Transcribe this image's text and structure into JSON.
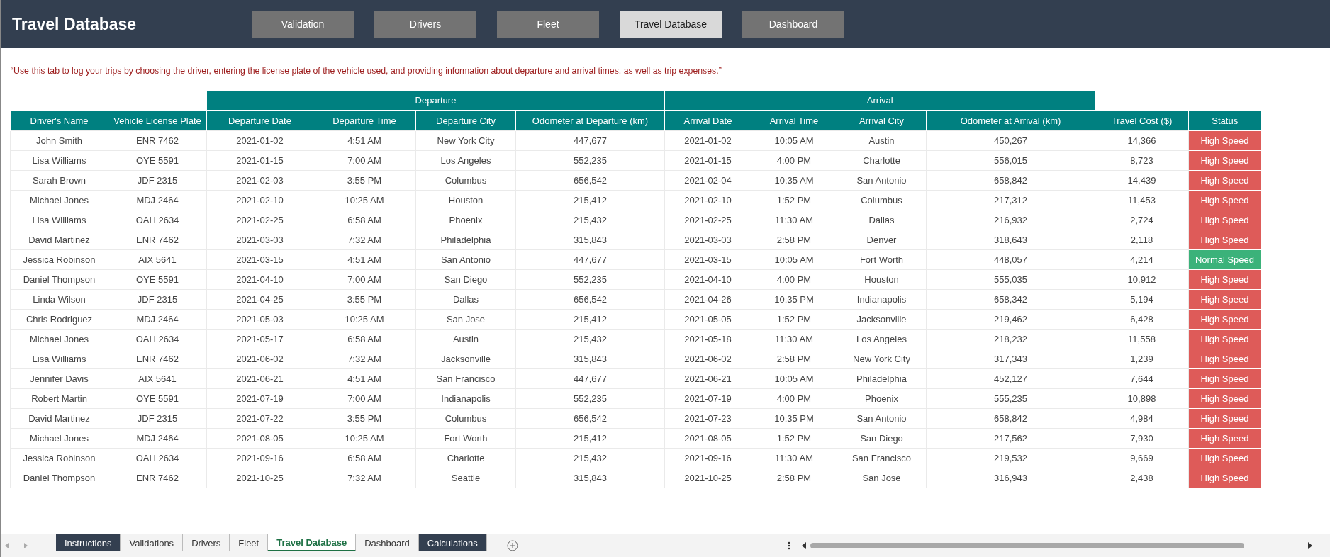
{
  "header": {
    "title": "Travel Database",
    "nav": [
      {
        "label": "Validation",
        "selected": false
      },
      {
        "label": "Drivers",
        "selected": false
      },
      {
        "label": "Fleet",
        "selected": false
      },
      {
        "label": "Travel Database",
        "selected": true
      },
      {
        "label": "Dashboard",
        "selected": false
      }
    ]
  },
  "note": "“Use this tab to log your trips by choosing the driver, entering the license plate of the vehicle used, and providing information about departure and arrival times, as well as trip expenses.”",
  "table": {
    "groups": [
      "Departure",
      "Arrival"
    ],
    "columns": [
      "Driver's Name",
      "Vehicle License Plate",
      "Departure Date",
      "Departure Time",
      "Departure City",
      "Odometer at Departure (km)",
      "Arrival Date",
      "Arrival Time",
      "Arrival City",
      "Odometer at Arrival (km)",
      "Travel Cost ($)",
      "Status"
    ],
    "rows": [
      {
        "cells": [
          "John Smith",
          "ENR 7462",
          "2021-01-02",
          "4:51 AM",
          "New York City",
          "447,677",
          "2021-01-02",
          "10:05 AM",
          "Austin",
          "450,267",
          "14,366"
        ],
        "status": "High Speed",
        "color": "#de5b59"
      },
      {
        "cells": [
          "Lisa Williams",
          "OYE 5591",
          "2021-01-15",
          "7:00 AM",
          "Los Angeles",
          "552,235",
          "2021-01-15",
          "4:00 PM",
          "Charlotte",
          "556,015",
          "8,723"
        ],
        "status": "High Speed",
        "color": "#de5b59"
      },
      {
        "cells": [
          "Sarah Brown",
          "JDF 2315",
          "2021-02-03",
          "3:55 PM",
          "Columbus",
          "656,542",
          "2021-02-04",
          "10:35 AM",
          "San Antonio",
          "658,842",
          "14,439"
        ],
        "status": "High Speed",
        "color": "#de5b59"
      },
      {
        "cells": [
          "Michael Jones",
          "MDJ 2464",
          "2021-02-10",
          "10:25 AM",
          "Houston",
          "215,412",
          "2021-02-10",
          "1:52 PM",
          "Columbus",
          "217,312",
          "11,453"
        ],
        "status": "High Speed",
        "color": "#de5b59"
      },
      {
        "cells": [
          "Lisa Williams",
          "OAH 2634",
          "2021-02-25",
          "6:58 AM",
          "Phoenix",
          "215,432",
          "2021-02-25",
          "11:30 AM",
          "Dallas",
          "216,932",
          "2,724"
        ],
        "status": "High Speed",
        "color": "#de5b59"
      },
      {
        "cells": [
          "David Martinez",
          "ENR 7462",
          "2021-03-03",
          "7:32 AM",
          "Philadelphia",
          "315,843",
          "2021-03-03",
          "2:58 PM",
          "Denver",
          "318,643",
          "2,118"
        ],
        "status": "High Speed",
        "color": "#de5b59"
      },
      {
        "cells": [
          "Jessica Robinson",
          "AIX 5641",
          "2021-03-15",
          "4:51 AM",
          "San Antonio",
          "447,677",
          "2021-03-15",
          "10:05 AM",
          "Fort Worth",
          "448,057",
          "4,214"
        ],
        "status": "Normal Speed",
        "color": "#3bb27a"
      },
      {
        "cells": [
          "Daniel Thompson",
          "OYE 5591",
          "2021-04-10",
          "7:00 AM",
          "San Diego",
          "552,235",
          "2021-04-10",
          "4:00 PM",
          "Houston",
          "555,035",
          "10,912"
        ],
        "status": "High Speed",
        "color": "#de5b59"
      },
      {
        "cells": [
          "Linda Wilson",
          "JDF 2315",
          "2021-04-25",
          "3:55 PM",
          "Dallas",
          "656,542",
          "2021-04-26",
          "10:35 PM",
          "Indianapolis",
          "658,342",
          "5,194"
        ],
        "status": "High Speed",
        "color": "#de5b59"
      },
      {
        "cells": [
          "Chris Rodriguez",
          "MDJ 2464",
          "2021-05-03",
          "10:25 AM",
          "San Jose",
          "215,412",
          "2021-05-05",
          "1:52 PM",
          "Jacksonville",
          "219,462",
          "6,428"
        ],
        "status": "High Speed",
        "color": "#de5b59"
      },
      {
        "cells": [
          "Michael Jones",
          "OAH 2634",
          "2021-05-17",
          "6:58 AM",
          "Austin",
          "215,432",
          "2021-05-18",
          "11:30 AM",
          "Los Angeles",
          "218,232",
          "11,558"
        ],
        "status": "High Speed",
        "color": "#de5b59"
      },
      {
        "cells": [
          "Lisa Williams",
          "ENR 7462",
          "2021-06-02",
          "7:32 AM",
          "Jacksonville",
          "315,843",
          "2021-06-02",
          "2:58 PM",
          "New York City",
          "317,343",
          "1,239"
        ],
        "status": "High Speed",
        "color": "#de5b59"
      },
      {
        "cells": [
          "Jennifer Davis",
          "AIX 5641",
          "2021-06-21",
          "4:51 AM",
          "San Francisco",
          "447,677",
          "2021-06-21",
          "10:05 AM",
          "Philadelphia",
          "452,127",
          "7,644"
        ],
        "status": "High Speed",
        "color": "#de5b59"
      },
      {
        "cells": [
          "Robert Martin",
          "OYE 5591",
          "2021-07-19",
          "7:00 AM",
          "Indianapolis",
          "552,235",
          "2021-07-19",
          "4:00 PM",
          "Phoenix",
          "555,235",
          "10,898"
        ],
        "status": "High Speed",
        "color": "#de5b59"
      },
      {
        "cells": [
          "David Martinez",
          "JDF 2315",
          "2021-07-22",
          "3:55 PM",
          "Columbus",
          "656,542",
          "2021-07-23",
          "10:35 PM",
          "San Antonio",
          "658,842",
          "4,984"
        ],
        "status": "High Speed",
        "color": "#de5b59"
      },
      {
        "cells": [
          "Michael Jones",
          "MDJ 2464",
          "2021-08-05",
          "10:25 AM",
          "Fort Worth",
          "215,412",
          "2021-08-05",
          "1:52 PM",
          "San Diego",
          "217,562",
          "7,930"
        ],
        "status": "High Speed",
        "color": "#de5b59"
      },
      {
        "cells": [
          "Jessica Robinson",
          "OAH 2634",
          "2021-09-16",
          "6:58 AM",
          "Charlotte",
          "215,432",
          "2021-09-16",
          "11:30 AM",
          "San Francisco",
          "219,532",
          "9,669"
        ],
        "status": "High Speed",
        "color": "#de5b59"
      },
      {
        "cells": [
          "Daniel Thompson",
          "ENR 7462",
          "2021-10-25",
          "7:32 AM",
          "Seattle",
          "315,843",
          "2021-10-25",
          "2:58 PM",
          "San Jose",
          "316,943",
          "2,438"
        ],
        "status": "High Speed",
        "color": "#de5b59"
      }
    ]
  },
  "sheet_tabs": [
    {
      "label": "Instructions",
      "selected": false,
      "dark": true
    },
    {
      "label": "Validations",
      "selected": false,
      "dark": false
    },
    {
      "label": "Drivers",
      "selected": false,
      "dark": false
    },
    {
      "label": "Fleet",
      "selected": false,
      "dark": false
    },
    {
      "label": "Travel Database",
      "selected": true,
      "dark": false
    },
    {
      "label": "Dashboard",
      "selected": false,
      "dark": false
    },
    {
      "label": "Calculations",
      "selected": false,
      "dark": true
    }
  ]
}
